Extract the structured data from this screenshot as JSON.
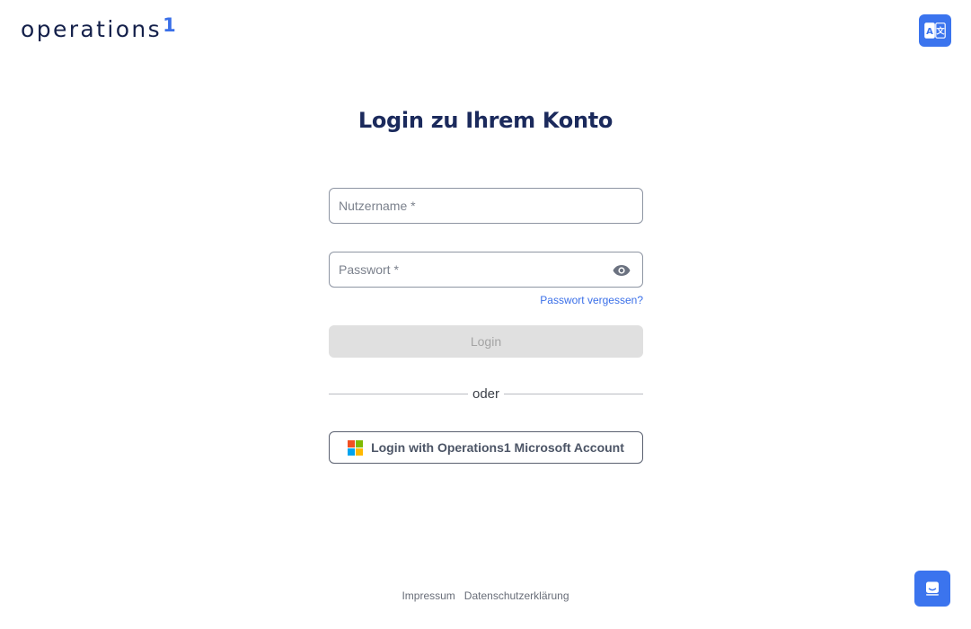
{
  "brand": {
    "name": "operations",
    "superscript": "1"
  },
  "header": {
    "language_icon": "translate-icon"
  },
  "login": {
    "title": "Login zu Ihrem Konto",
    "username": {
      "placeholder": "Nutzername *",
      "value": ""
    },
    "password": {
      "placeholder": "Passwort *",
      "value": "",
      "toggle_icon": "eye-icon"
    },
    "forgot_label": "Passwort vergessen?",
    "submit_label": "Login",
    "divider_label": "oder",
    "microsoft_label": "Login with Operations1 Microsoft Account",
    "microsoft_icon": "microsoft-logo-icon"
  },
  "footer": {
    "impressum": "Impressum",
    "privacy": "Datenschutzerklärung"
  },
  "support": {
    "chat_icon": "chat-icon"
  },
  "colors": {
    "accent": "#3b74ee",
    "title": "#1b2a5c",
    "link": "#3a6fe8",
    "disabled_bg": "#e0e0e0"
  }
}
